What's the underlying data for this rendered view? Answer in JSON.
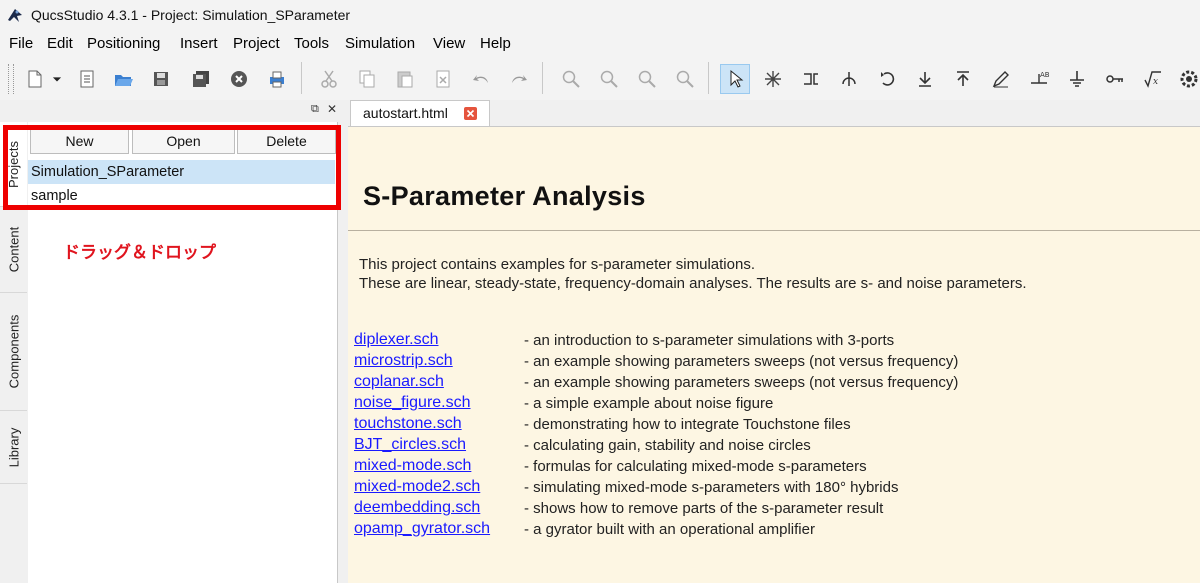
{
  "window": {
    "title": "QucsStudio 4.3.1 - Project: Simulation_SParameter"
  },
  "menu": [
    "File",
    "Edit",
    "Positioning",
    "Insert",
    "Project",
    "Tools",
    "Simulation",
    "View",
    "Help"
  ],
  "dock": {
    "float_icon": "⧉",
    "close_icon": "✕",
    "vertical_tabs": [
      "Projects",
      "Content",
      "Components",
      "Library"
    ],
    "buttons": {
      "new": "New",
      "open": "Open",
      "delete": "Delete"
    },
    "projects": [
      "Simulation_SParameter",
      "sample"
    ],
    "annotation": "ドラッグ＆ドロップ"
  },
  "editor": {
    "tab_label": "autostart.html",
    "heading": "S-Parameter Analysis",
    "description_lines": [
      "This project contains examples for s-parameter simulations.",
      "These are linear, steady-state, frequency-domain analyses. The results are s- and noise parameters."
    ],
    "links": [
      {
        "file": "diplexer.sch",
        "desc": "- an introduction to s-parameter simulations with 3-ports"
      },
      {
        "file": "microstrip.sch",
        "desc": "- an example showing parameters sweeps (not versus frequency)"
      },
      {
        "file": "coplanar.sch",
        "desc": "- an example showing parameters sweeps (not versus frequency)"
      },
      {
        "file": "noise_figure.sch",
        "desc": "- a simple example about noise figure"
      },
      {
        "file": "touchstone.sch",
        "desc": "- demonstrating how to integrate Touchstone files"
      },
      {
        "file": "BJT_circles.sch",
        "desc": "- calculating gain, stability and noise circles"
      },
      {
        "file": "mixed-mode.sch",
        "desc": "- formulas for calculating mixed-mode s-parameters"
      },
      {
        "file": "mixed-mode2.sch",
        "desc": "- simulating mixed-mode s-parameters with 180°  hybrids"
      },
      {
        "file": "deembedding.sch",
        "desc": "- shows how to remove parts of the s-parameter result"
      },
      {
        "file": "opamp_gyrator.sch",
        "desc": "- a gyrator built with an operational amplifier"
      }
    ]
  },
  "colors": {
    "highlight_box": "#ee0000",
    "annotation": "#e0141e",
    "link": "#1a1aff",
    "content_bg": "#fdf6e3",
    "selection": "#cce4f7"
  }
}
